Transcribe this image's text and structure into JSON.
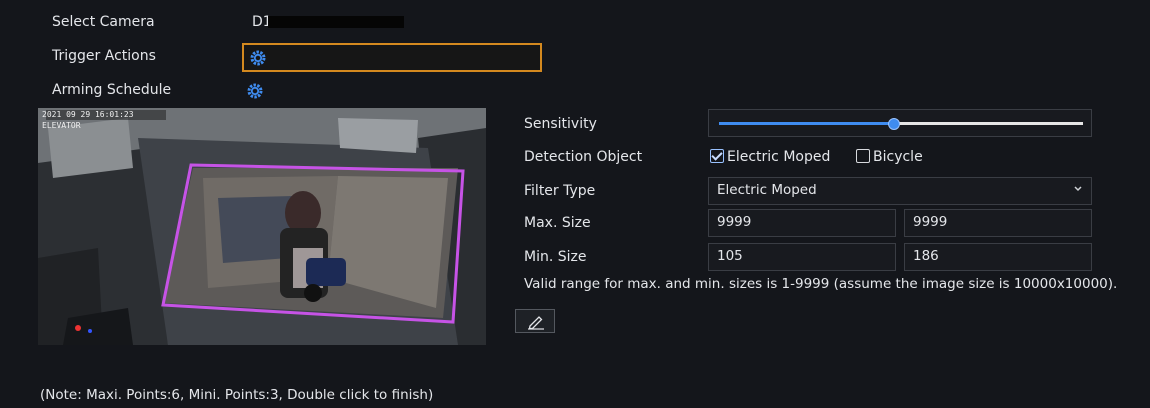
{
  "camera": {
    "label": "Select Camera",
    "value": "D1"
  },
  "trigger": {
    "label": "Trigger Actions",
    "icon": "gear-icon"
  },
  "schedule": {
    "label": "Arming Schedule",
    "icon": "gear-icon"
  },
  "preview": {
    "timestamp": "2021 09 29 16:01:23",
    "channel": "ELEVATOR"
  },
  "sensitivity": {
    "label": "Sensitivity",
    "value_percent": 48
  },
  "detection": {
    "label": "Detection Object",
    "options": [
      {
        "label": "Electric Moped",
        "checked": true
      },
      {
        "label": "Bicycle",
        "checked": false
      }
    ]
  },
  "filter": {
    "label": "Filter Type",
    "value": "Electric Moped"
  },
  "max_size": {
    "label": "Max. Size",
    "width": "9999",
    "height": "9999"
  },
  "min_size": {
    "label": "Min. Size",
    "width": "105",
    "height": "186"
  },
  "valid_range_note": "Valid range for max. and min. sizes is 1-9999 (assume the image size is 10000x10000).",
  "draw_tool": {
    "icon": "pen-icon"
  },
  "footer_note": "(Note: Maxi. Points:6, Mini. Points:3, Double click to finish)",
  "colors": {
    "accent": "#3f8cf0",
    "focus": "#d4891f",
    "region": "#c653e6"
  }
}
